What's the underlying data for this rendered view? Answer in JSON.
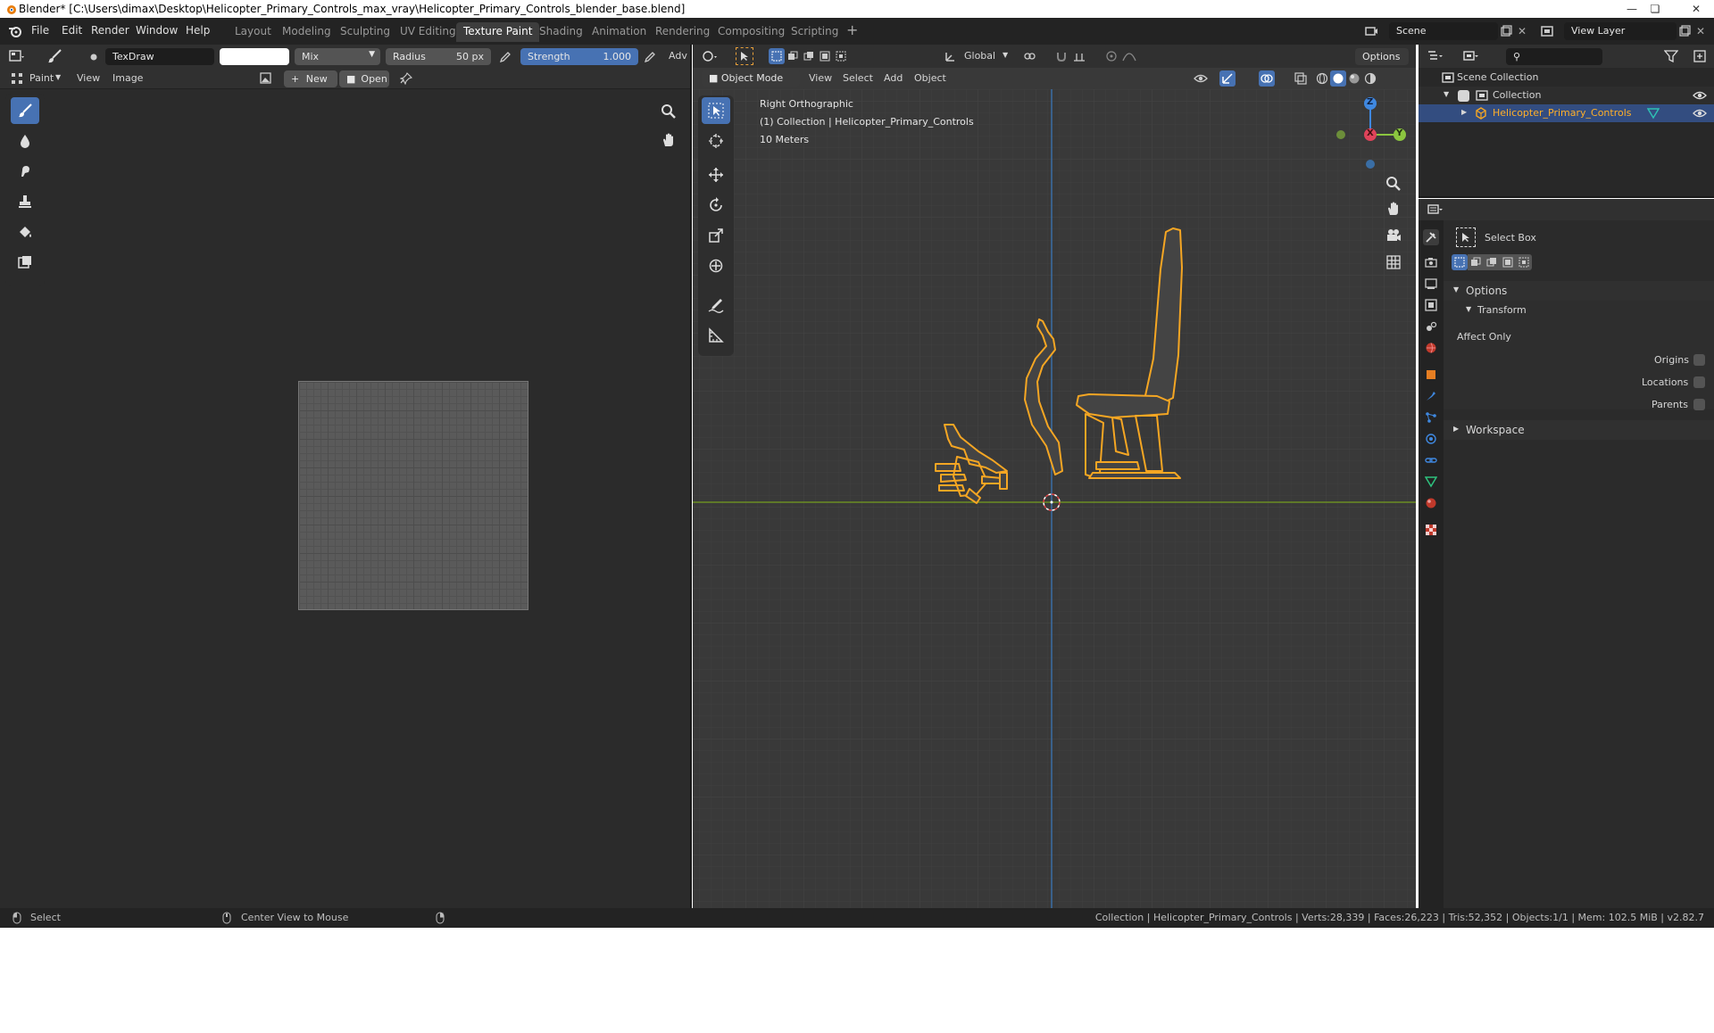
{
  "window": {
    "title": "Blender* [C:\\Users\\dimax\\Desktop\\Helicopter_Primary_Controls_max_vray\\Helicopter_Primary_Controls_blender_base.blend]"
  },
  "menu": {
    "items": [
      "File",
      "Edit",
      "Render",
      "Window",
      "Help"
    ]
  },
  "workspaces": {
    "tabs": [
      "Layout",
      "Modeling",
      "Sculpting",
      "UV Editing",
      "Texture Paint",
      "Shading",
      "Animation",
      "Rendering",
      "Compositing",
      "Scripting"
    ],
    "active": "Texture Paint",
    "add_label": "+"
  },
  "topright": {
    "scene": "Scene",
    "view_layer": "View Layer"
  },
  "image_editor": {
    "brush_name": "TexDraw",
    "blend_mode": "Mix",
    "radius_label": "Radius",
    "radius_value": "50 px",
    "strength_label": "Strength",
    "strength_value": "1.000",
    "adv_label": "Adv",
    "mode_label": "Paint",
    "view_menu": "View",
    "image_menu": "Image",
    "new_label": "New",
    "open_label": "Open"
  },
  "viewport": {
    "orientation": "Global",
    "options_label": "Options",
    "mode": "Object Mode",
    "menus": [
      "View",
      "Select",
      "Add",
      "Object"
    ],
    "overlay_view": "Right Orthographic",
    "overlay_collection": "(1) Collection | Helicopter_Primary_Controls",
    "overlay_scale": "10 Meters",
    "gizmo": {
      "z": "Z",
      "y": "Y",
      "x": "X"
    },
    "colors": {
      "selection_outline": "#f5a623",
      "x_axis": "#e0435a",
      "y_axis": "#8bc53f",
      "z_axis": "#3f88e0",
      "grid_bg": "#393939"
    }
  },
  "outliner": {
    "root": "Scene Collection",
    "collection": "Collection",
    "object": "Helicopter_Primary_Controls"
  },
  "properties": {
    "tool_name": "Select Box",
    "options_label": "Options",
    "transform_label": "Transform",
    "affect_only": "Affect Only",
    "origins": "Origins",
    "locations": "Locations",
    "parents": "Parents",
    "workspace_label": "Workspace"
  },
  "statusbar": {
    "select": "Select",
    "center_view": "Center View to Mouse",
    "stats": "Collection | Helicopter_Primary_Controls | Verts:28,339 | Faces:26,223 | Tris:52,352 | Objects:1/1 | Mem: 102.5 MiB | v2.82.7"
  }
}
